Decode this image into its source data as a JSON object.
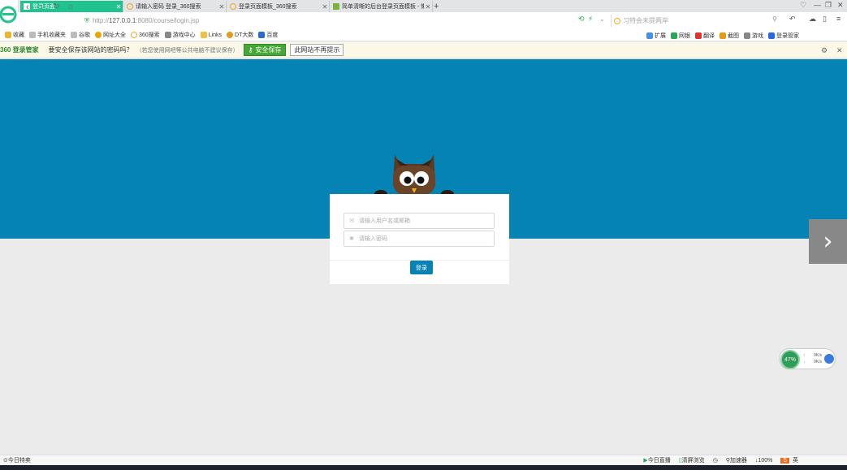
{
  "tabs": [
    {
      "title": "登录页面",
      "active": true
    },
    {
      "title": "请输入密码 登录_360搜索",
      "active": false
    },
    {
      "title": "登录页面模板_360搜索",
      "active": false
    },
    {
      "title": "简单清晰的后台登录页面模板 - 懒",
      "active": false
    }
  ],
  "nav": {
    "url_scheme": "http://",
    "url_host": "127.0.0.1",
    "url_path": ":8080/course/login.jsp",
    "search_placeholder": "习特会未提两岸"
  },
  "bookmarks": [
    "收藏",
    "手机收藏夹",
    "谷歌",
    "网址大全",
    "360搜索",
    "游戏中心",
    "Links",
    "DT大数",
    "百度"
  ],
  "right_bookmarks": [
    "扩展",
    "网银",
    "翻译",
    "截图",
    "游戏",
    "登录管家"
  ],
  "infobar": {
    "brand": "360 登录管家",
    "question": "要安全保存该网站的密码吗？",
    "hint": "（若您使用网吧等公共电脑不建议保存）",
    "save_button": "安全保存",
    "never_button": "此网站不再提示"
  },
  "login": {
    "username_placeholder": "请输入用户名或邮箱",
    "password_placeholder": "请输入密码",
    "login_button": "登录"
  },
  "speed_widget": {
    "percent": "47%",
    "up": "0K/s",
    "down": "0K/s"
  },
  "statusbar": {
    "left": "今日特卖",
    "items": [
      "今日直播",
      "清屏浏览",
      "加速器",
      "100%"
    ],
    "ime": "英"
  },
  "colors": {
    "primary_blue": "#0483b4",
    "active_tab": "#20c28e",
    "save_green": "#46a636"
  }
}
